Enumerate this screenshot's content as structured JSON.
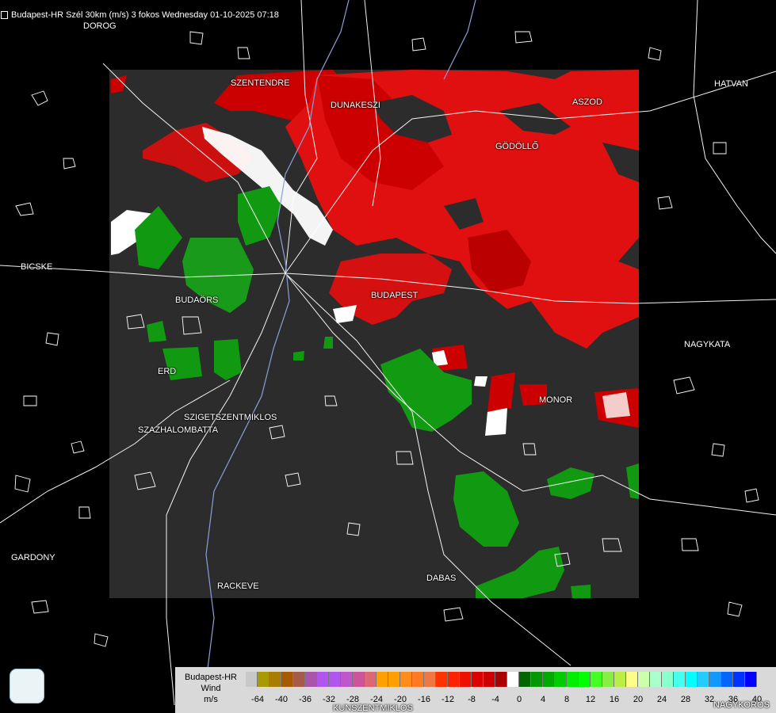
{
  "header": {
    "title": "Budapest-HR Szél 30km (m/s) 3 fokos Wednesday 01-10-2025 07:18"
  },
  "cities": [
    {
      "name": "DOROG"
    },
    {
      "name": "SZENTENDRE"
    },
    {
      "name": "DUNAKESZI"
    },
    {
      "name": "ASZOD"
    },
    {
      "name": "HATVAN"
    },
    {
      "name": "GÖDÖLLŐ"
    },
    {
      "name": "BICSKE"
    },
    {
      "name": "BUDAÖRS"
    },
    {
      "name": "BUDAPEST"
    },
    {
      "name": "NAGYKATA"
    },
    {
      "name": "ERD"
    },
    {
      "name": "MONOR"
    },
    {
      "name": "SZIGETSZENTMIKLOS"
    },
    {
      "name": "SZAZHALOMBATTA"
    },
    {
      "name": "GARDONY"
    },
    {
      "name": "RACKEVE"
    },
    {
      "name": "DABAS"
    },
    {
      "name": "KUNSZENTMIKLOS"
    },
    {
      "name": "NAGYKOROS"
    }
  ],
  "logo": {
    "icon": "weather-service-logo-icon"
  },
  "legend": {
    "title_line1": "Budapest-HR",
    "title_line2": "Wind",
    "title_line3": "m/s",
    "colors": [
      "#c8c8c8",
      "#a89a00",
      "#a87d00",
      "#a85a00",
      "#a65a48",
      "#aa55aa",
      "#b055ee",
      "#b055ee",
      "#c055cc",
      "#cc5599",
      "#dd6677",
      "#ffa000",
      "#ffa000",
      "#ff8c1a",
      "#ff7a22",
      "#ee7744",
      "#ff3300",
      "#ff2200",
      "#ee1100",
      "#dd0000",
      "#cc0000",
      "#aa0000",
      "#ffffff",
      "#006600",
      "#009900",
      "#00aa00",
      "#00cc00",
      "#00ee00",
      "#00ff00",
      "#44ff22",
      "#88ee44",
      "#bbee44",
      "#ffff88",
      "#ccffaa",
      "#aaffcc",
      "#88ffcc",
      "#44ffee",
      "#00ffff",
      "#22ccff",
      "#1199ff",
      "#0066ff",
      "#0033ff",
      "#0000ff"
    ],
    "ticks": [
      "-64",
      "-40",
      "-36",
      "-32",
      "-28",
      "-24",
      "-20",
      "-16",
      "-12",
      "-8",
      "-4",
      "0",
      "4",
      "8",
      "12",
      "16",
      "20",
      "24",
      "28",
      "32",
      "36",
      "40"
    ]
  }
}
